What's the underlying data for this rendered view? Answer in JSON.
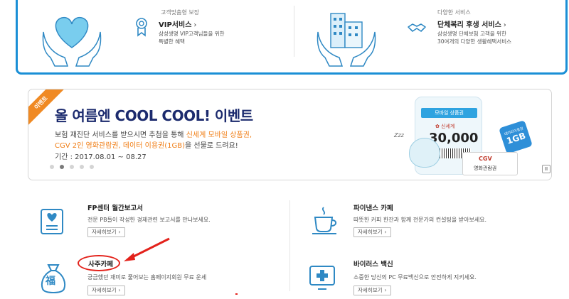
{
  "top_services": {
    "left": {
      "caption_top": "고객맞춤형 보장",
      "title": "VIP서비스",
      "arrow": "›",
      "desc_line1": "삼성생명 VIP고객님들을 위한",
      "desc_line2": "특별한 혜택"
    },
    "right": {
      "caption_top": "다양한 서비스",
      "title": "단체복리 후생 서비스",
      "arrow": "›",
      "desc_line1": "삼성생명 단체보험 고객을 위한",
      "desc_line2": "30여개의 다양한 생활혜택서비스"
    }
  },
  "banner": {
    "ribbon": "이벤트",
    "title": "올 여름엔 COOL COOL! 이벤트",
    "line1_prefix": "보험 재진단 서비스를 받으시면 추첨을 통해 ",
    "line1_highlight": "신세계 모바일 상품권,",
    "line2_highlight": "CGV 2인 영화관람권, 데이터 이용권(1GB)",
    "line2_suffix": "을 선물로 드려요!",
    "line3": "기간 : 2017.08.01 ~ 08.27",
    "phone_header": "모바일 상품권",
    "brand": "신세계",
    "amount": "30,000",
    "cgv_logo": "CGV",
    "cgv_text": "영화관람권",
    "gb_small": "데이터이용권",
    "gb_big": "1GB",
    "zzz": "Zzz",
    "pause": "II",
    "dots_total": 5,
    "active_dot": 2
  },
  "grid": {
    "fp_report": {
      "title": "FP센터 월간보고서",
      "desc": "전문 PB들이 작성한 경제관련 보고서를 만나보세요.",
      "more": "자세히보기"
    },
    "finance_cafe": {
      "title": "파이낸스 카페",
      "desc": "따뜻한 커피 한잔과 함께 전문가의 컨설팅을 받아보세요.",
      "more": "자세히보기"
    },
    "saju_cafe": {
      "title": "사주카페",
      "desc": "궁금했던 재미로 풀어보는 홈페이지회원 무료 운세",
      "more": "자세히보기",
      "icon_char": "福"
    },
    "virus": {
      "title": "바이러스 백신",
      "desc": "소중한 당신의 PC 무료백신으로 안전하게 지키세요.",
      "more": "자세히보기"
    }
  },
  "more_chevron": "›",
  "colors": {
    "accent_blue": "#1a8fd6",
    "banner_title": "#1c2b6e",
    "highlight_orange": "#f07d14",
    "annotation_red": "#e3221b"
  }
}
